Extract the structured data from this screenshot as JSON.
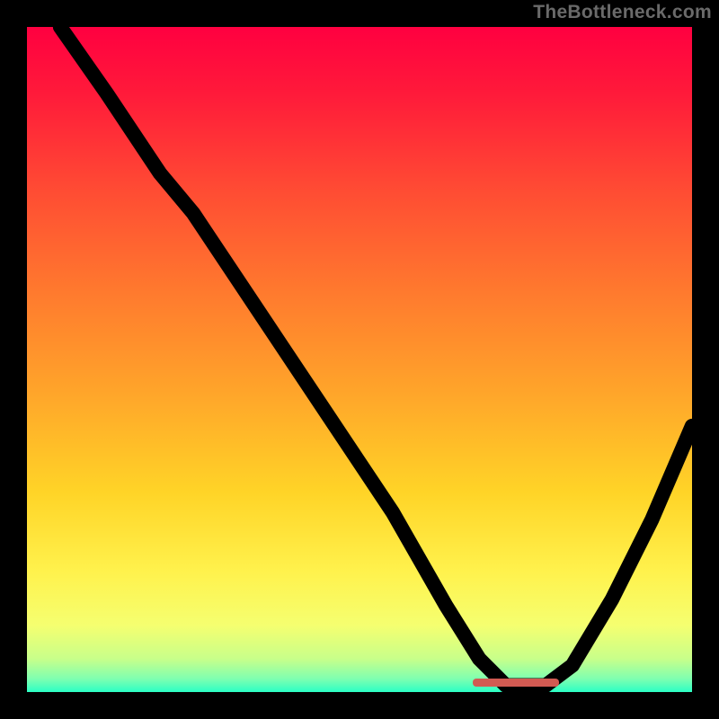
{
  "watermark": "TheBottleneck.com",
  "colors": {
    "page_bg": "#000000",
    "curve": "#000000",
    "marker": "#d15a52",
    "gradient_stops": [
      {
        "offset": "0%",
        "color": "#ff0040"
      },
      {
        "offset": "10%",
        "color": "#ff1a3a"
      },
      {
        "offset": "25%",
        "color": "#ff4d33"
      },
      {
        "offset": "40%",
        "color": "#ff7a2e"
      },
      {
        "offset": "55%",
        "color": "#ffa52a"
      },
      {
        "offset": "70%",
        "color": "#ffd427"
      },
      {
        "offset": "82%",
        "color": "#fff24d"
      },
      {
        "offset": "90%",
        "color": "#f5ff70"
      },
      {
        "offset": "95%",
        "color": "#c8ff8a"
      },
      {
        "offset": "98%",
        "color": "#7fffb0"
      },
      {
        "offset": "100%",
        "color": "#2bffc5"
      }
    ]
  },
  "chart_data": {
    "type": "line",
    "title": "",
    "xlabel": "",
    "ylabel": "",
    "xlim": [
      0,
      100
    ],
    "ylim": [
      0,
      100
    ],
    "series": [
      {
        "name": "bottleneck-curve",
        "x": [
          5,
          12,
          20,
          25,
          35,
          45,
          55,
          63,
          68,
          72,
          78,
          82,
          88,
          94,
          100
        ],
        "y": [
          100,
          90,
          78,
          72,
          57,
          42,
          27,
          13,
          5,
          1,
          1,
          4,
          14,
          26,
          40
        ]
      }
    ],
    "marker": {
      "x_start": 67,
      "x_end": 80,
      "y": 1.5
    }
  }
}
